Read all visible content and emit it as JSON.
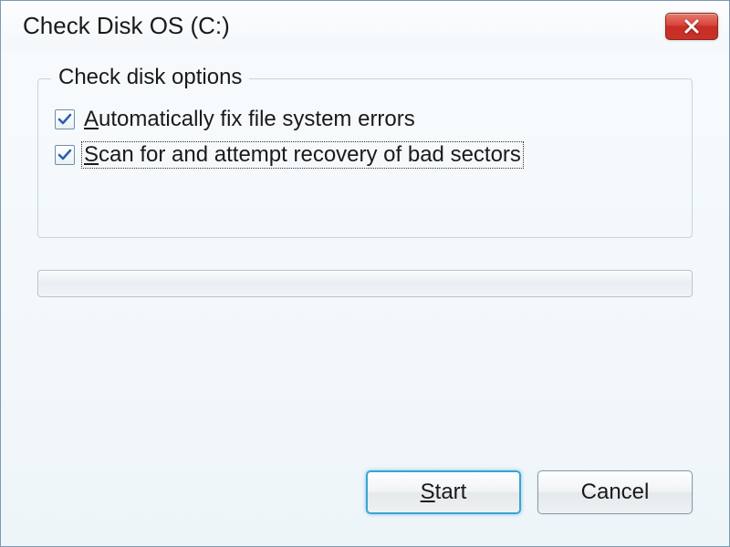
{
  "window": {
    "title": "Check Disk OS (C:)"
  },
  "group": {
    "legend": "Check disk options"
  },
  "options": {
    "autofix": {
      "label": "Automatically fix file system errors",
      "checked": true
    },
    "scanbad": {
      "label": "Scan for and attempt recovery of bad sectors",
      "checked": true
    }
  },
  "buttons": {
    "start": "Start",
    "cancel": "Cancel"
  }
}
